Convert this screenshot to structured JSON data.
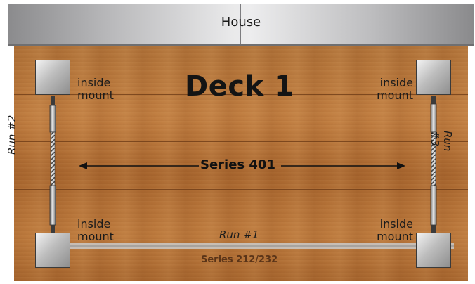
{
  "house": {
    "label": "House"
  },
  "deck": {
    "title": "Deck 1"
  },
  "mounts": {
    "top_left": "inside mount",
    "top_right": "inside mount",
    "bottom_left": "inside mount",
    "bottom_right": "inside mount"
  },
  "runs": {
    "left": "Run #2",
    "right": "Run #3",
    "bottom": "Run #1"
  },
  "series": {
    "middle": "Series 401",
    "bottom": "Series 212/232"
  },
  "colors": {
    "house_gray": "#bdbdbf",
    "deck_wood": "#b07238",
    "text": "#141414"
  }
}
